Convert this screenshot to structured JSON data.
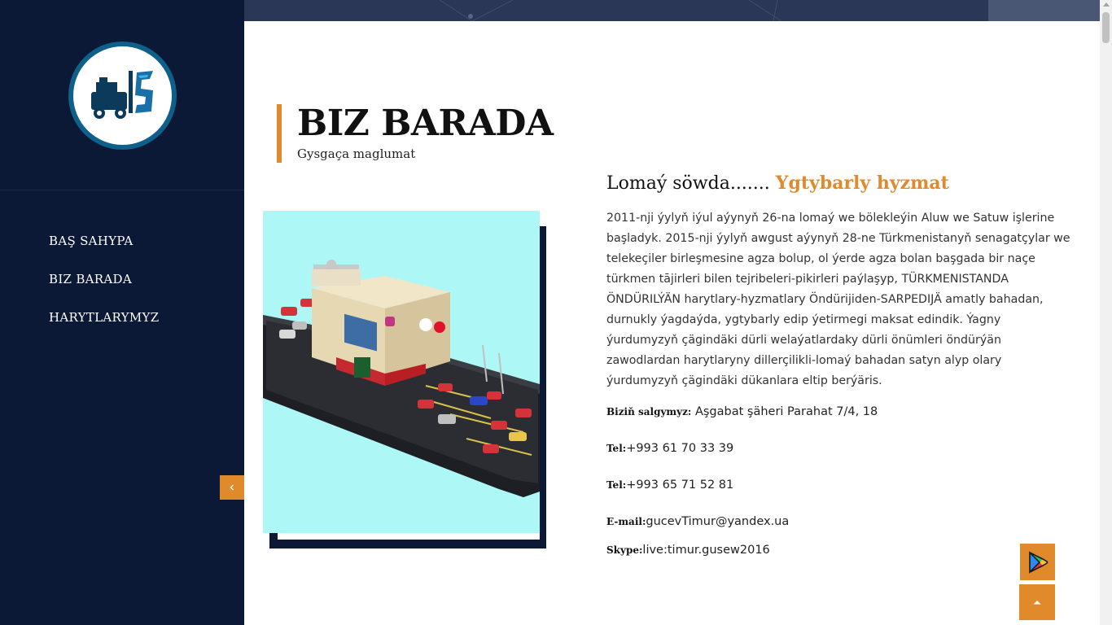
{
  "sidebar": {
    "logo_alt": "IS logo",
    "nav": [
      {
        "label": "BAŞ SAHYPA"
      },
      {
        "label": "BIZ BARADA"
      },
      {
        "label": "HARYTLARYMYZ"
      }
    ],
    "collapse_icon": "chevron-left-icon"
  },
  "header": {
    "title": "BIZ BARADA",
    "subtitle": "Gysgaça maglumat"
  },
  "about": {
    "tagline_prefix": "Lomaý söwda.......",
    "tagline_accent": "Ygtybarly hyzmat",
    "paragraph": "2011-nji ýylyň iýul aýynyň 26-na lomaý we bölekleýin Aluw we Satuw işlerine başladyk. 2015-nji ýylyň awgust aýynyň 28-ne Türkmenistanyň senagatçylar we telekeçiler birleşmesine agza bolup, ol ýerde agza bolan başgada bir naçe türkmen tājirleri bilen tejribeleri-pikirleri paýlaşyp, TÜRKMENISTANDA ÖNDÜRILÝÄN harytlary-hyzmatlary Öndürijiden-SARPEDIJÄ amatly bahadan, durnukly ýagdaýda, ygtybarly edip ýetirmegi maksat edindik. Ýagny ýurdumyzyň çägindäki dürli welaýatlardaky dürli önümleri öndürýän zawodlardan harytlaryny dillerçilikli-lomaý bahadan satyn alyp olary ýurdumyzyň çägindäki dükanlara eltip berýäris."
  },
  "contacts": {
    "address_label": "Biziň salgymyz:",
    "address_value": "Aşgabat şäheri Parahat 7/4, 18",
    "tel1_label": "Tel:",
    "tel1_value": "+993 61 70 33 39",
    "tel2_label": "Tel:",
    "tel2_value": "+993 65 71 52 81",
    "email_label": "E-mail:",
    "email_value": "gucevTimur@yandex.ua",
    "skype_label": "Skype:",
    "skype_value": "live:timur.gusew2016"
  },
  "fabs": {
    "play_icon": "google-play-icon",
    "top_icon": "arrow-up-icon"
  },
  "colors": {
    "sidebar_bg": "#0b1836",
    "accent": "#e08a2c",
    "image_bg": "#aef7f7"
  }
}
